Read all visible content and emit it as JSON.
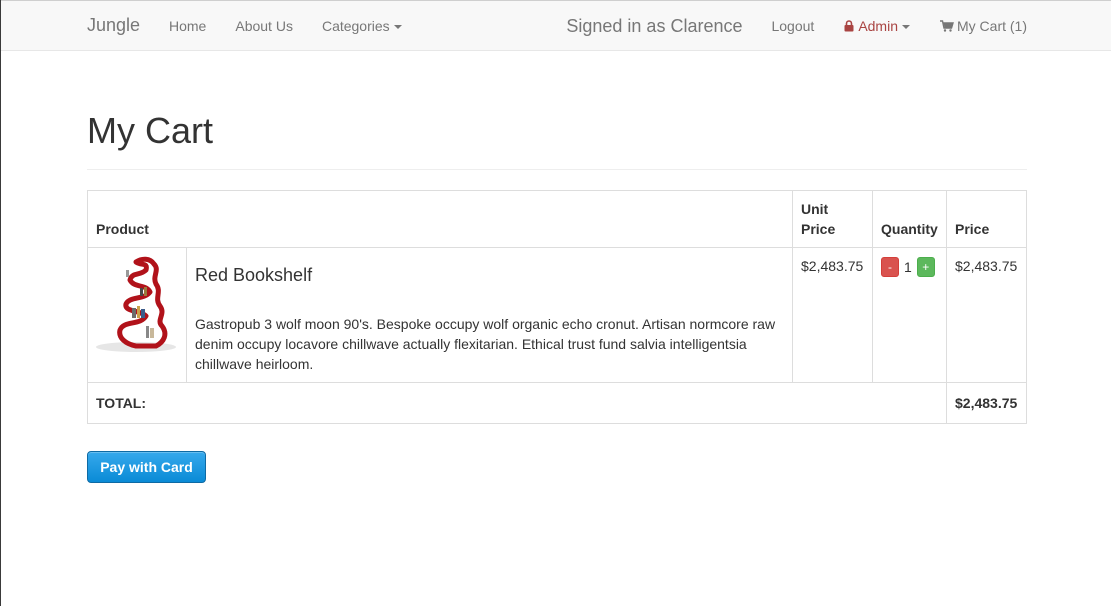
{
  "navbar": {
    "brand": "Jungle",
    "left_links": [
      {
        "label": "Home"
      },
      {
        "label": "About Us"
      },
      {
        "label": "Categories"
      }
    ],
    "signed_in": "Signed in as Clarence",
    "logout": "Logout",
    "admin": "Admin",
    "cart": "My Cart (1)"
  },
  "page": {
    "title": "My Cart"
  },
  "table": {
    "headers": {
      "product": "Product",
      "unit_price": "Unit Price",
      "quantity": "Quantity",
      "price": "Price"
    },
    "items": [
      {
        "name": "Red Bookshelf",
        "description": "Gastropub 3 wolf moon 90's. Bespoke occupy wolf organic echo cronut. Artisan normcore raw denim occupy locavore chillwave actually flexitarian. Ethical trust fund salvia intelligentsia chillwave heirloom.",
        "unit_price": "$2,483.75",
        "quantity": "1",
        "minus": "-",
        "plus": "+",
        "price": "$2,483.75"
      }
    ],
    "total_label": "TOTAL:",
    "total_value": "$2,483.75"
  },
  "pay_button": "Pay with Card",
  "colors": {
    "pay_button": "#0a8bd6",
    "minus": "#d9534f",
    "plus": "#5cb85c",
    "admin": "#a94442"
  },
  "icons": {
    "admin": "lock-icon",
    "cart": "shopping-cart-icon"
  }
}
